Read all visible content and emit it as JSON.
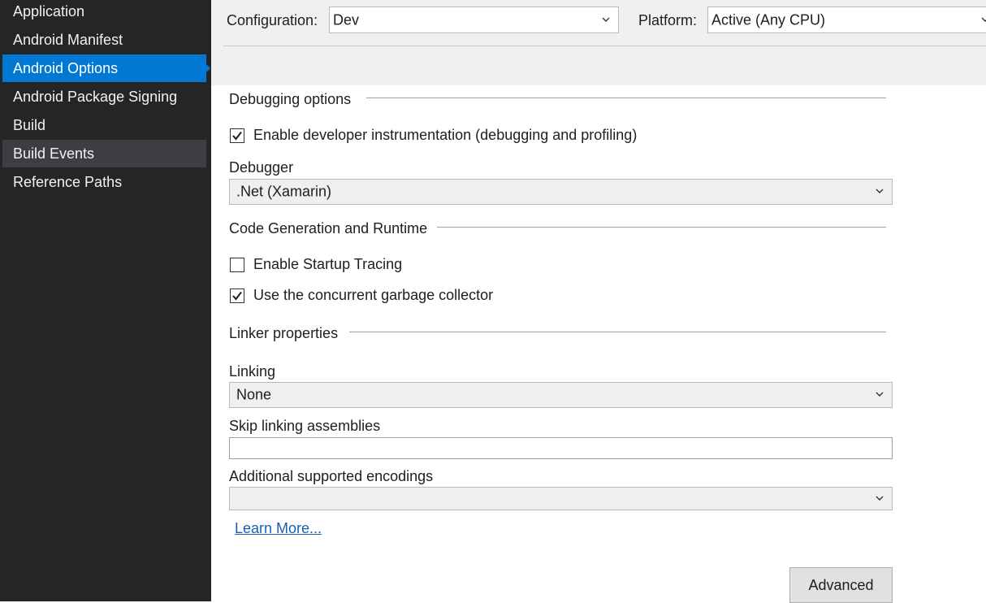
{
  "sidebar": {
    "items": [
      {
        "label": "Application"
      },
      {
        "label": "Android Manifest"
      },
      {
        "label": "Android Options"
      },
      {
        "label": "Android Package Signing"
      },
      {
        "label": "Build"
      },
      {
        "label": "Build Events"
      },
      {
        "label": "Reference Paths"
      }
    ],
    "selected_index": 2,
    "hovered_index": 5
  },
  "toolbar": {
    "configuration_label": "Configuration:",
    "configuration_value": "Dev",
    "platform_label": "Platform:",
    "platform_value": "Active (Any CPU)"
  },
  "debugging": {
    "section_title": "Debugging options",
    "enable_instrumentation_label": "Enable developer instrumentation (debugging and profiling)",
    "enable_instrumentation_checked": true,
    "debugger_label": "Debugger",
    "debugger_value": ".Net (Xamarin)"
  },
  "codegen": {
    "section_title": "Code Generation and Runtime",
    "startup_tracing_label": "Enable Startup Tracing",
    "startup_tracing_checked": false,
    "concurrent_gc_label": "Use the concurrent garbage collector",
    "concurrent_gc_checked": true
  },
  "linker": {
    "section_title": "Linker properties",
    "linking_label": "Linking",
    "linking_value": "None",
    "skip_assemblies_label": "Skip linking assemblies",
    "skip_assemblies_value": "",
    "encodings_label": "Additional supported encodings",
    "encodings_value": ""
  },
  "learn_more_label": "Learn More...",
  "advanced_button_label": "Advanced",
  "colors": {
    "sidebar_bg": "#252526",
    "selected_bg": "#0078d4",
    "hover_bg": "#3e3e42",
    "link": "#1a5fb4"
  }
}
